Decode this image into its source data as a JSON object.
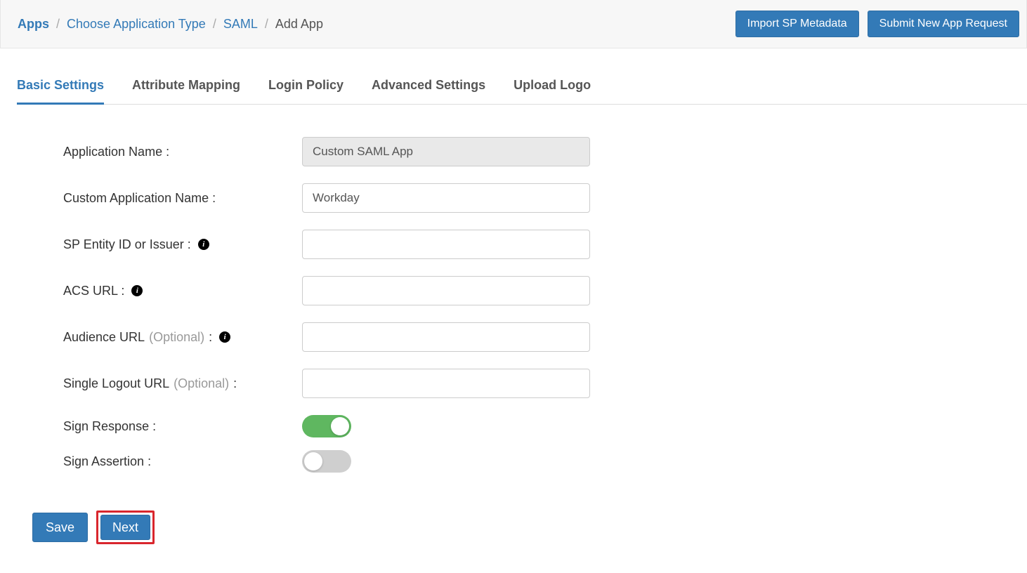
{
  "breadcrumb": {
    "apps": "Apps",
    "choose": "Choose Application Type",
    "saml": "SAML",
    "current": "Add App"
  },
  "actions": {
    "import": "Import SP Metadata",
    "submit": "Submit New App Request"
  },
  "tabs": {
    "basic": "Basic Settings",
    "attribute": "Attribute Mapping",
    "login": "Login Policy",
    "advanced": "Advanced Settings",
    "upload": "Upload Logo"
  },
  "form": {
    "app_name_label": "Application Name :",
    "app_name_value": "Custom SAML App",
    "custom_name_label": "Custom Application Name :",
    "custom_name_value": "Workday",
    "sp_entity_label": "SP Entity ID or Issuer :",
    "sp_entity_value": "",
    "acs_label": "ACS URL :",
    "acs_value": "",
    "audience_label_pre": "Audience URL ",
    "audience_label_opt": "(Optional)",
    "audience_label_post": " :",
    "audience_value": "",
    "slo_label_pre": "Single Logout URL ",
    "slo_label_opt": "(Optional)",
    "slo_label_post": " :",
    "slo_value": "",
    "sign_response_label": "Sign Response :",
    "sign_assertion_label": "Sign Assertion :"
  },
  "toggles": {
    "sign_response": true,
    "sign_assertion": false
  },
  "footer": {
    "save": "Save",
    "next": "Next"
  }
}
